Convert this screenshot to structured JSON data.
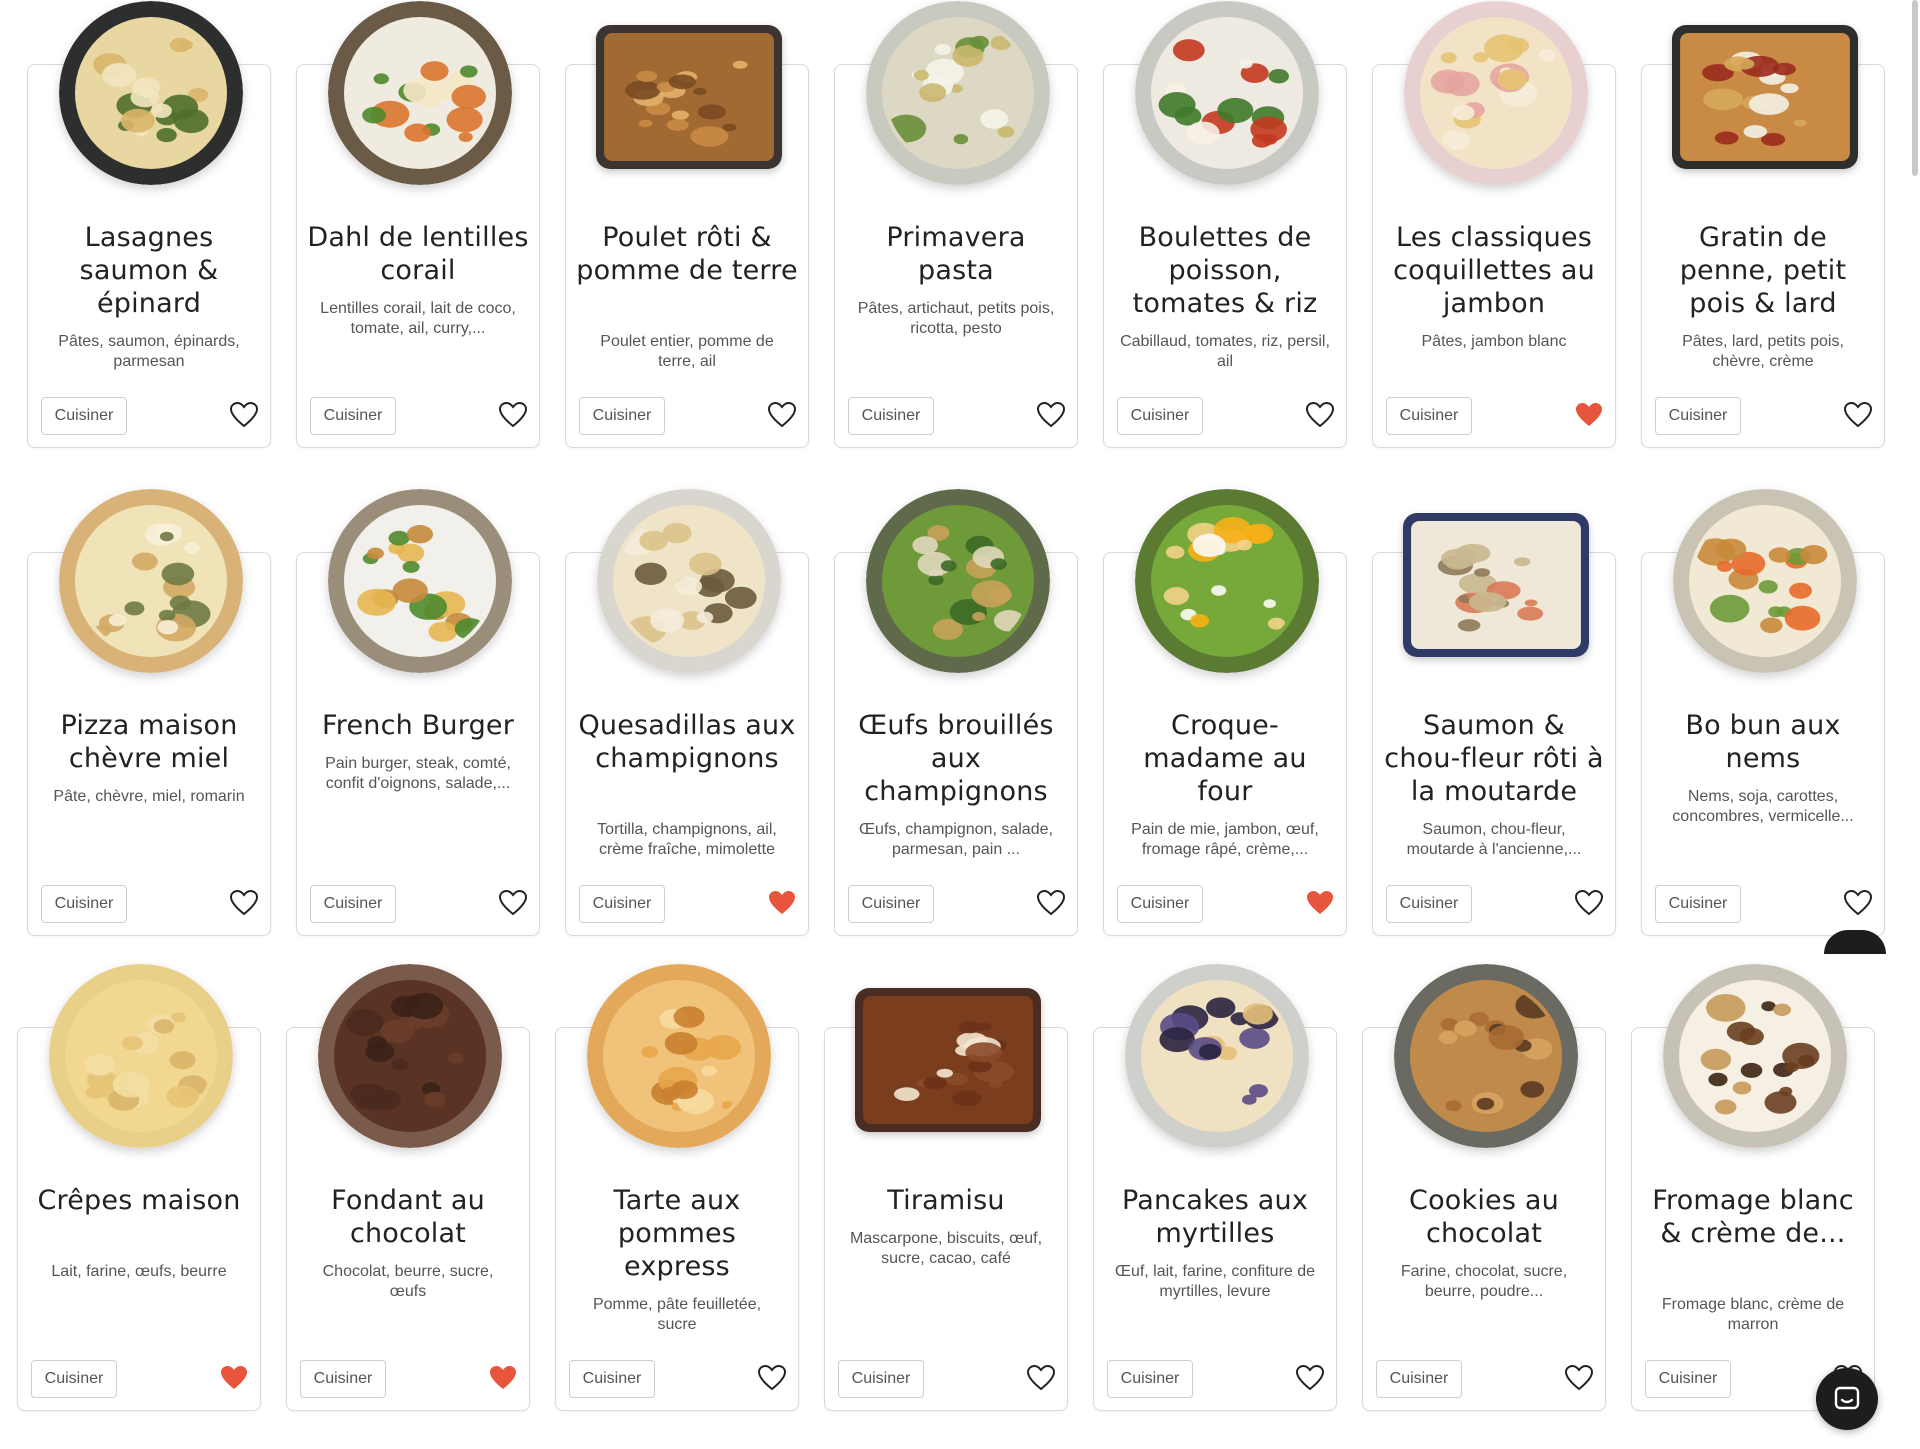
{
  "colors": {
    "favorite_active": "#e8553d",
    "favorite_outline": "#222222",
    "card_border": "#d9d9d9",
    "chat_button": "#1d1d1d"
  },
  "chat_widget": {
    "icon": "chat-icon"
  },
  "recipes": [
    [
      {
        "title": "Lasagnes saumon & épinard",
        "desc": "Pâtes, saumon, épinards, parmesan",
        "button": "Cuisiner",
        "favorite": false
      },
      {
        "title": "Dahl de lentilles corail",
        "desc": "Lentilles corail, lait de coco, tomate, ail, curry,...",
        "button": "Cuisiner",
        "favorite": false
      },
      {
        "title": "Poulet rôti & pomme de terre",
        "desc": "Poulet entier, pomme de terre, ail",
        "button": "Cuisiner",
        "favorite": false
      },
      {
        "title": "Primavera pasta",
        "desc": "Pâtes, artichaut, petits pois, ricotta, pesto",
        "button": "Cuisiner",
        "favorite": false
      },
      {
        "title": "Boulettes de poisson, tomates & riz",
        "desc": "Cabillaud, tomates, riz, persil, ail",
        "button": "Cuisiner",
        "favorite": false
      },
      {
        "title": "Les classiques coquillettes au jambon",
        "desc": "Pâtes, jambon blanc",
        "button": "Cuisiner",
        "favorite": true
      },
      {
        "title": "Gratin de penne, petit pois & lard",
        "desc": "Pâtes, lard, petits pois, chèvre, crème",
        "button": "Cuisiner",
        "favorite": false
      }
    ],
    [
      {
        "title": "Pizza maison chèvre miel",
        "desc": "Pâte, chèvre, miel, romarin",
        "button": "Cuisiner",
        "favorite": false
      },
      {
        "title": "French Burger",
        "desc": "Pain burger, steak, comté, confit d'oignons, salade,...",
        "button": "Cuisiner",
        "favorite": false
      },
      {
        "title": "Quesadillas aux champignons",
        "desc": "Tortilla, champignons, ail, crème fraîche, mimolette",
        "button": "Cuisiner",
        "favorite": true
      },
      {
        "title": "Œufs brouillés aux champignons",
        "desc": "Œufs, champignon, salade, parmesan, pain ...",
        "button": "Cuisiner",
        "favorite": false
      },
      {
        "title": "Croque-madame au four",
        "desc": "Pain de mie, jambon, œuf, fromage râpé, crème,...",
        "button": "Cuisiner",
        "favorite": true
      },
      {
        "title": "Saumon & chou-fleur rôti à la moutarde",
        "desc": "Saumon, chou-fleur, moutarde à l'ancienne,...",
        "button": "Cuisiner",
        "favorite": false
      },
      {
        "title": "Bo bun aux nems",
        "desc": "Nems, soja, carottes, concombres, vermicelle...",
        "button": "Cuisiner",
        "favorite": false
      }
    ],
    [
      {
        "title": "Crêpes maison",
        "desc": "Lait, farine, œufs, beurre",
        "button": "Cuisiner",
        "favorite": true
      },
      {
        "title": "Fondant au chocolat",
        "desc": "Chocolat, beurre, sucre, œufs",
        "button": "Cuisiner",
        "favorite": true
      },
      {
        "title": "Tarte aux pommes express",
        "desc": "Pomme, pâte feuilletée, sucre",
        "button": "Cuisiner",
        "favorite": false
      },
      {
        "title": "Tiramisu",
        "desc": "Mascarpone, biscuits, œuf, sucre, cacao, café",
        "button": "Cuisiner",
        "favorite": false
      },
      {
        "title": "Pancakes aux myrtilles",
        "desc": "Œuf, lait, farine, confiture de myrtilles, levure",
        "button": "Cuisiner",
        "favorite": false
      },
      {
        "title": "Cookies au chocolat",
        "desc": "Farine, chocolat, sucre, beurre, poudre...",
        "button": "Cuisiner",
        "favorite": false
      },
      {
        "title": "Fromage blanc & crème de...",
        "desc": "Fromage blanc, crème de marron",
        "button": "Cuisiner",
        "favorite": false
      }
    ]
  ]
}
